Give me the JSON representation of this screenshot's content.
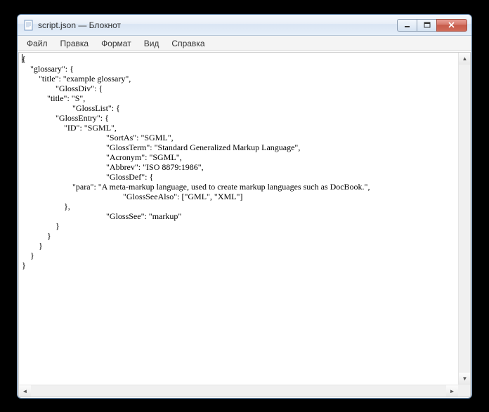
{
  "window": {
    "title": "script.json — Блокнот"
  },
  "menu": {
    "file": "Файл",
    "edit": "Правка",
    "format": "Формат",
    "view": "Вид",
    "help": "Справка"
  },
  "editor": {
    "content": "{\n    \"glossary\": {\n        \"title\": \"example glossary\",\n\t\t\"GlossDiv\": {\n            \"title\": \"S\",\n\t\t\t\"GlossList\": {\n                \"GlossEntry\": {\n                    \"ID\": \"SGML\",\n\t\t\t\t\t\"SortAs\": \"SGML\",\n\t\t\t\t\t\"GlossTerm\": \"Standard Generalized Markup Language\",\n\t\t\t\t\t\"Acronym\": \"SGML\",\n\t\t\t\t\t\"Abbrev\": \"ISO 8879:1986\",\n\t\t\t\t\t\"GlossDef\": {\n                        \"para\": \"A meta-markup language, used to create markup languages such as DocBook.\",\n\t\t\t\t\t\t\"GlossSeeAlso\": [\"GML\", \"XML\"]\n                    },\n\t\t\t\t\t\"GlossSee\": \"markup\"\n                }\n            }\n        }\n    }\n}"
  }
}
